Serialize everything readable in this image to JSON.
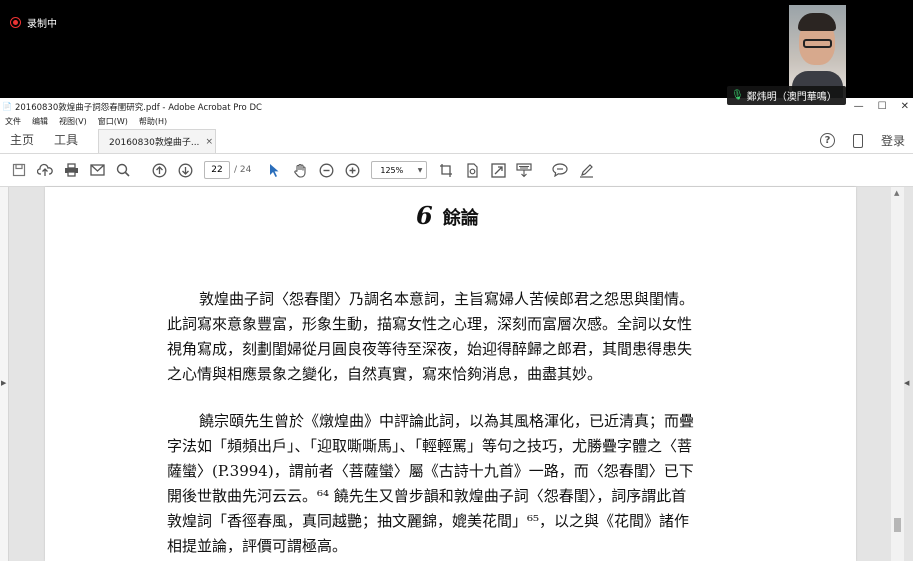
{
  "meeting": {
    "recording_label": "录制中",
    "participant_name": "鄭炜明（澳門華鳴）"
  },
  "window": {
    "title": "20160830敦煌曲子詞怨春閨研究.pdf - Adobe Acrobat Pro DC",
    "controls": [
      "—",
      "☐",
      "✕"
    ]
  },
  "menu": [
    "文件",
    "编辑",
    "视图(V)",
    "窗口(W)",
    "帮助(H)"
  ],
  "tabs": {
    "home": "主页",
    "tools": "工具",
    "document": "20160830敦煌曲子...",
    "close": "×",
    "signin": "登录",
    "help": "?"
  },
  "toolbar": {
    "icons": [
      "save-icon",
      "upload-icon",
      "print-icon",
      "email-icon",
      "search-icon",
      "page-up-icon",
      "page-down-icon",
      "select-pointer-icon",
      "hand-icon",
      "zoom-out-icon",
      "zoom-in-icon",
      "crop-icon",
      "rotate-icon",
      "fit-page-icon",
      "keyboard-icon",
      "comment-icon",
      "sign-icon"
    ],
    "current_page": "22",
    "total_pages": "/ 24",
    "zoom": "125%"
  },
  "document": {
    "chapter_number": "6",
    "chapter_title": "餘論",
    "paragraph1": [
      "敦煌曲子詞〈怨春閨〉乃調名本意詞，主旨寫婦人苦候郎君之怨思與閨情。",
      "此詞寫來意象豐富，形象生動，描寫女性之心理，深刻而富層次感。全詞以女性",
      "視角寫成，刻劃閨婦從月圓良夜等待至深夜，始迎得醉歸之郎君，其間患得患失",
      "之心情與相應景象之變化，自然真實，寫來恰夠消息，曲盡其妙。"
    ],
    "paragraph2": [
      "饒宗頤先生曾於《燉煌曲》中評論此詞，以為其風格渾化，已近清真；而疊",
      "字法如「頻頻出戶」、「迎取嘶嘶馬」、「輕輕罵」等句之技巧，尤勝疊字體之〈菩",
      "薩蠻〉(P.3994)，謂前者〈菩薩蠻〉屬《古詩十九首》一路，而〈怨春閨〉已下",
      "開後世散曲先河云云。⁶⁴ 饒先生又曾步韻和敦煌曲子詞〈怨春閨〉，詞序謂此首",
      "敦煌詞「香徑春風，真同越艷；抽文麗錦，媲美花間」⁶⁵，以之與《花間》諸作",
      "相提並論，評價可謂極高。"
    ]
  }
}
